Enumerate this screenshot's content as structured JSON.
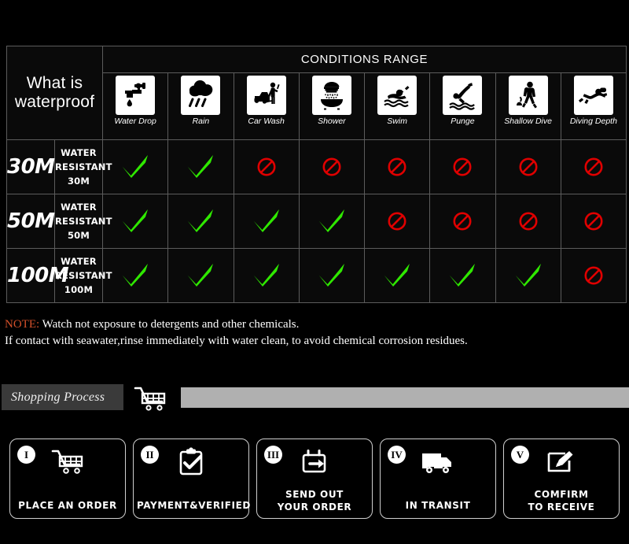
{
  "table": {
    "title": "What is waterproof",
    "conditions_header": "CONDITIONS RANGE",
    "columns": [
      {
        "label": "Water Drop",
        "icon": "faucet-drop-icon"
      },
      {
        "label": "Rain",
        "icon": "rain-cloud-icon"
      },
      {
        "label": "Car Wash",
        "icon": "car-wash-icon"
      },
      {
        "label": "Shower",
        "icon": "shower-icon"
      },
      {
        "label": "Swim",
        "icon": "swimmer-icon"
      },
      {
        "label": "Punge",
        "icon": "plunge-dive-icon"
      },
      {
        "label": "Shallow Dive",
        "icon": "shallow-dive-icon"
      },
      {
        "label": "Diving Depth",
        "icon": "scuba-diver-icon"
      }
    ],
    "rows": [
      {
        "badge": "30M",
        "description": "WATER RESISTANT  30M",
        "marks": [
          "yes",
          "yes",
          "no",
          "no",
          "no",
          "no",
          "no",
          "no"
        ]
      },
      {
        "badge": "50M",
        "description": "WATER RESISTANT 50M",
        "marks": [
          "yes",
          "yes",
          "yes",
          "yes",
          "no",
          "no",
          "no",
          "no"
        ]
      },
      {
        "badge": "100M",
        "description": "WATER RESISTANT  100M",
        "marks": [
          "yes",
          "yes",
          "yes",
          "yes",
          "yes",
          "yes",
          "yes",
          "no"
        ]
      }
    ]
  },
  "note": {
    "keyword": "NOTE:",
    "line1": " Watch not exposure to detergents and other chemicals.",
    "line2": "If contact with seawater,rinse immediately with water clean, to avoid chemical corrosion residues."
  },
  "shopping": {
    "label": "Shopping Process",
    "cart_icon": "shopping-cart-icon"
  },
  "steps": [
    {
      "numeral": "I",
      "line1": "PLACE AN ORDER",
      "line2": "",
      "icon": "cart-icon"
    },
    {
      "numeral": "II",
      "line1": "PAYMENT&VERIFIED",
      "line2": "",
      "icon": "clipboard-check-icon"
    },
    {
      "numeral": "III",
      "line1": "SEND OUT",
      "line2": "YOUR ORDER",
      "icon": "package-arrow-icon"
    },
    {
      "numeral": "IV",
      "line1": "IN TRANSIT",
      "line2": "",
      "icon": "delivery-truck-icon"
    },
    {
      "numeral": "V",
      "line1": "COMFIRM",
      "line2": "TO RECEIVE",
      "icon": "sign-receipt-icon"
    }
  ],
  "colors": {
    "check_green": "#2FE800",
    "deny_red": "#E00000",
    "note_keyword": "#d4502a",
    "gray_bar": "#b0b0b0",
    "background": "#000000"
  }
}
